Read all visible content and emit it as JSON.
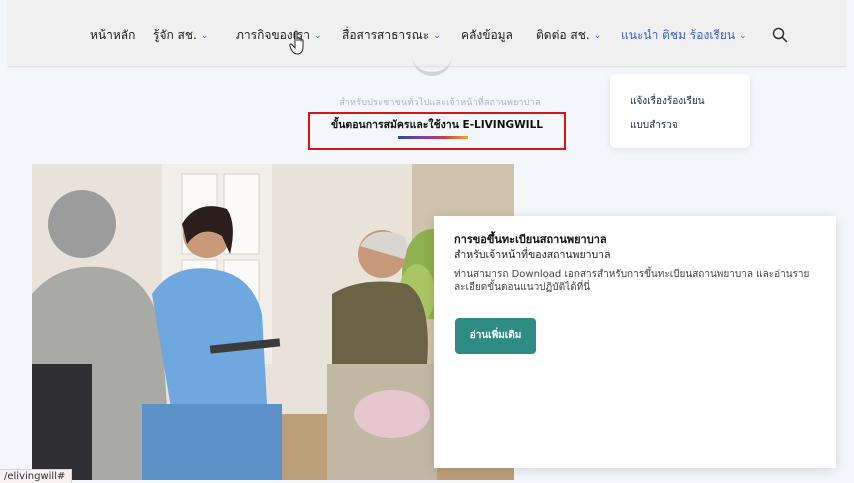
{
  "nav": {
    "items": [
      {
        "label": "หน้าหลัก",
        "has_dropdown": false
      },
      {
        "label": "รู้จัก สช.",
        "has_dropdown": true
      },
      {
        "label": "ภารกิจของเรา",
        "has_dropdown": true
      },
      {
        "label": "สื่อสารสาธารณะ",
        "has_dropdown": true
      },
      {
        "label": "คลังข้อมูล",
        "has_dropdown": false
      },
      {
        "label": "ติดต่อ สช.",
        "has_dropdown": true
      },
      {
        "label": "แนะนำ ติชม ร้องเรียน",
        "has_dropdown": true,
        "active": true
      }
    ],
    "search_icon": "search-icon"
  },
  "dropdown": {
    "items": [
      "แจ้งเรื่องร้องเรียน",
      "แบบสำรวจ"
    ]
  },
  "section": {
    "subtitle": "สำหรับประชาชนทั่วไปและเจ้าหน้าที่สถานพยาบาล",
    "title": "ขั้นตอนการสมัครและใช้งาน E-LIVINGWILL"
  },
  "card": {
    "title": "การขอขึ้นทะเบียนสถานพยาบาล",
    "subtitle": "สำหรับเจ้าหน้าที่ของสถานพยาบาล",
    "description": "ท่านสามารถ Download เอกสารสำหรับการขึ้นทะเบียนสถานพยาบาล และอ่านรายละเอียดขั้นตอนแนวปฏิบัติได้ที่นี่",
    "button": "อ่านเพิ่มเติม"
  },
  "status_bar": {
    "url": "/elivingwill#"
  },
  "colors": {
    "accent_blue": "#3a5fd0",
    "highlight_red": "#d3161b",
    "button_teal": "#2e8c84"
  }
}
